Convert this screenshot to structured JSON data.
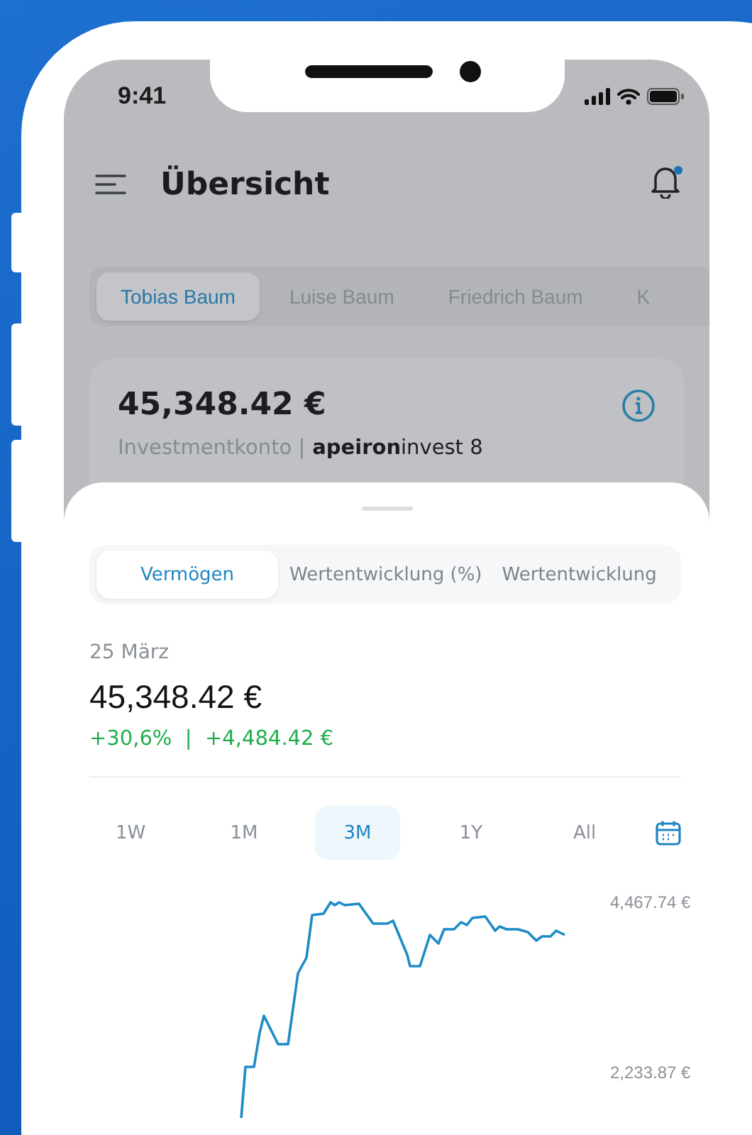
{
  "status_bar": {
    "time": "9:41"
  },
  "header": {
    "title": "Übersicht",
    "has_notification": true
  },
  "account_tabs": [
    {
      "label": "Tobias Baum",
      "selected": true
    },
    {
      "label": "Luise Baum",
      "selected": false
    },
    {
      "label": "Friedrich Baum",
      "selected": false
    },
    {
      "label": "K",
      "selected": false
    }
  ],
  "account_card": {
    "balance": "45,348.42 €",
    "account_type": "Investmentkonto |",
    "product": "**apeiron**invest 8"
  },
  "sheet": {
    "view_tabs": [
      {
        "label": "Vermögen",
        "selected": true
      },
      {
        "label": "Wertentwicklung (%)",
        "selected": false
      },
      {
        "label": "Wertentwicklung",
        "selected": false
      }
    ],
    "date": "25 März",
    "value": "45,348.42 €",
    "change": "+30,6%  |  +4,484.42 €",
    "periods": [
      {
        "label": "1W",
        "selected": false
      },
      {
        "label": "1M",
        "selected": false
      },
      {
        "label": "3M",
        "selected": true
      },
      {
        "label": "1Y",
        "selected": false
      },
      {
        "label": "All",
        "selected": false
      }
    ],
    "chart": {
      "y_labels": [
        "4,467.74 €",
        "2,233.87 €"
      ]
    }
  }
}
